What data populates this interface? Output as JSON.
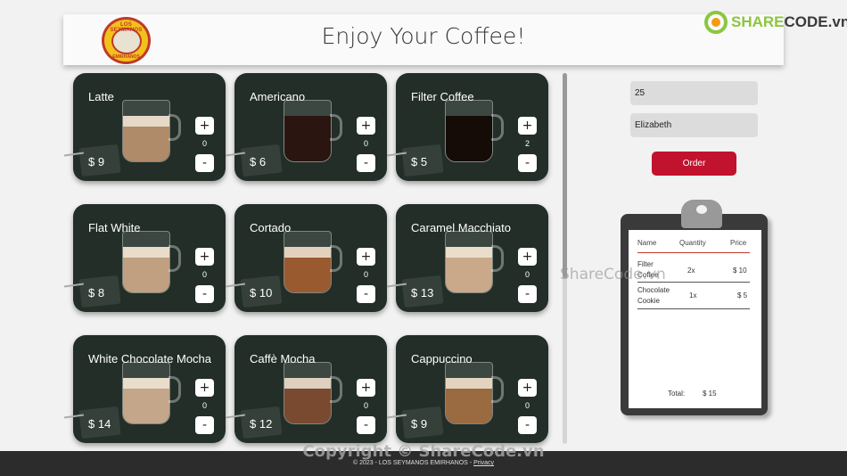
{
  "header": {
    "title": "Enjoy Your Coffee!",
    "logo_top": "LOS SEYMANOS",
    "logo_bottom": "EMIRHANOS"
  },
  "watermark": {
    "brand_a": "SHARE",
    "brand_b": "CODE",
    "brand_c": ".vn",
    "center": "ShareCode.vn",
    "footer": "Copyright © ShareCode.vn"
  },
  "menu": [
    {
      "name": "Latte",
      "price": "$ 9",
      "qty": "0",
      "fill": "#b08b6a",
      "foam": true
    },
    {
      "name": "Americano",
      "price": "$ 6",
      "qty": "0",
      "fill": "#2b1510",
      "foam": false
    },
    {
      "name": "Filter Coffee",
      "price": "$ 5",
      "qty": "2",
      "fill": "#150b07",
      "foam": false
    },
    {
      "name": "Flat White",
      "price": "$ 8",
      "qty": "0",
      "fill": "#c0a080",
      "foam": true
    },
    {
      "name": "Cortado",
      "price": "$ 10",
      "qty": "0",
      "fill": "#9a5a30",
      "foam": true
    },
    {
      "name": "Caramel Macchiato",
      "price": "$ 13",
      "qty": "0",
      "fill": "#c9a98a",
      "foam": true
    },
    {
      "name": "White Chocolate Mocha",
      "price": "$ 14",
      "qty": "0",
      "fill": "#c4a68a",
      "foam": true
    },
    {
      "name": "Caffè Mocha",
      "price": "$ 12",
      "qty": "0",
      "fill": "#7a4a30",
      "foam": true
    },
    {
      "name": "Cappuccino",
      "price": "$ 9",
      "qty": "0",
      "fill": "#9a6a40",
      "foam": true
    }
  ],
  "form": {
    "table_value": "25",
    "name_value": "Elizabeth",
    "order_label": "Order"
  },
  "receipt": {
    "col_name": "Name",
    "col_qty": "Quantity",
    "col_price": "Price",
    "rows": [
      {
        "name_1": "Filter",
        "name_2": "Coffee",
        "qty": "2x",
        "price": "$ 10"
      },
      {
        "name_1": "Chocolate",
        "name_2": "Cookie",
        "qty": "1x",
        "price": "$ 5"
      }
    ],
    "total_label": "Total:",
    "total_value": "$ 15"
  },
  "footer": {
    "text": "© 2023 - LOS SEYMANOS EMIRHANOS - ",
    "privacy": "Privacy"
  },
  "colors": {
    "card_bg": "#222e27",
    "accent": "#c1122e"
  }
}
